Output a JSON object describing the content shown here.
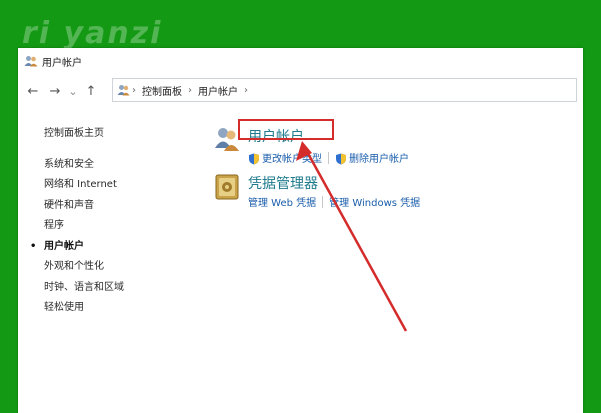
{
  "watermark": "ri yanzi",
  "window": {
    "title": "用户帐户",
    "nav": {
      "back": "←",
      "forward": "→",
      "dropdown": "⌄",
      "up": "↑"
    },
    "breadcrumb": [
      "控制面板",
      "用户帐户"
    ],
    "breadcrumb_sep": "›"
  },
  "sidebar": {
    "home": "控制面板主页",
    "items": [
      {
        "label": "系统和安全"
      },
      {
        "label": "网络和 Internet"
      },
      {
        "label": "硬件和声音"
      },
      {
        "label": "程序"
      },
      {
        "label": "用户帐户",
        "active": true
      },
      {
        "label": "外观和个性化"
      },
      {
        "label": "时钟、语言和区域"
      },
      {
        "label": "轻松使用"
      }
    ],
    "bullet": "•"
  },
  "main": {
    "categories": [
      {
        "title": "用户帐户",
        "icon": "users-icon",
        "links": [
          "更改帐户类型",
          "删除用户帐户"
        ]
      },
      {
        "title": "凭据管理器",
        "icon": "credential-vault-icon",
        "links": [
          "管理 Web 凭据",
          "管理 Windows 凭据"
        ]
      }
    ]
  },
  "annotation": {
    "color": "#d42b2b"
  },
  "colors": {
    "background": "#139913",
    "link": "#1a5dab",
    "category_title": "#1e7a8c"
  }
}
